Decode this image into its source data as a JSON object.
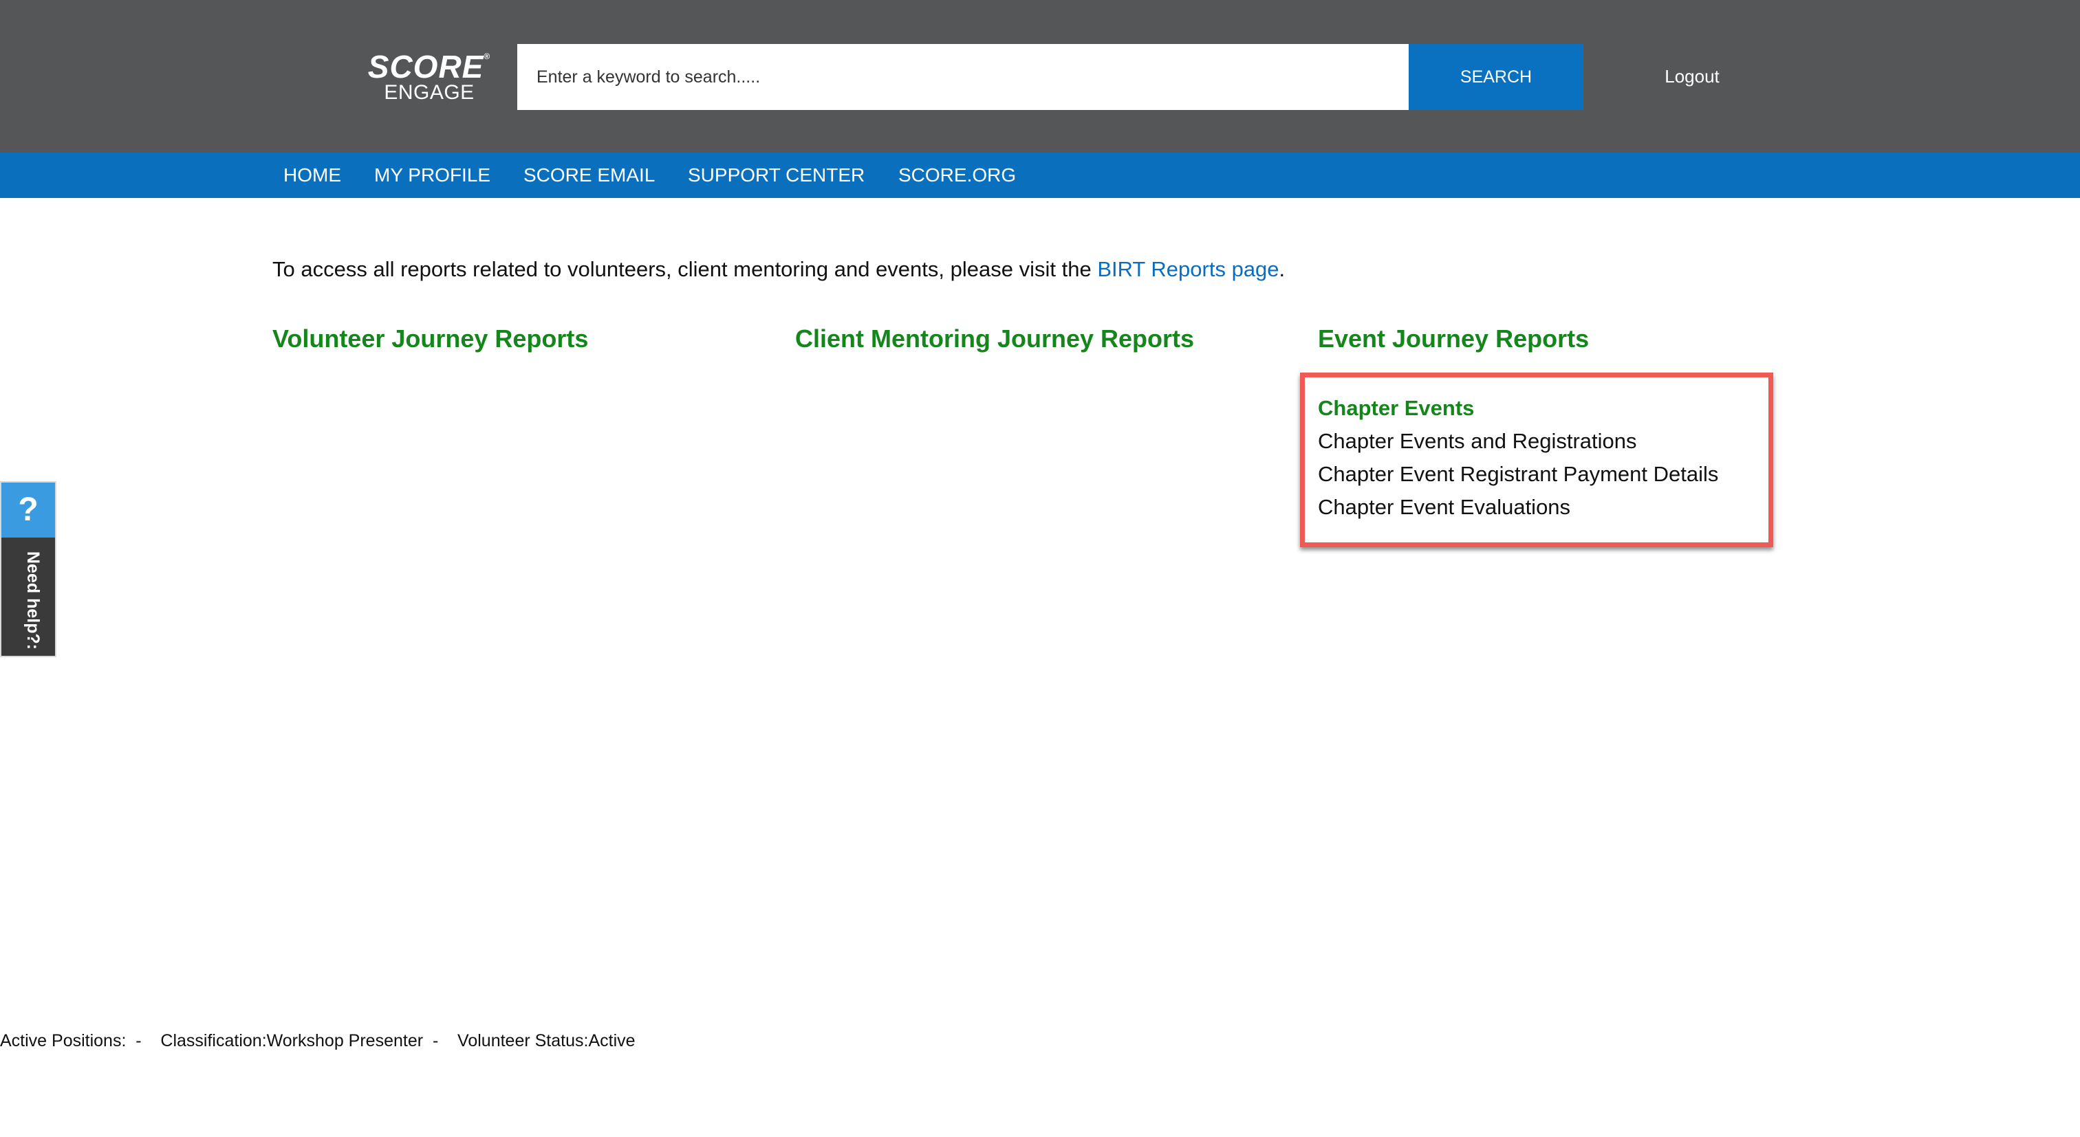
{
  "header": {
    "logo_line1": "SCORE",
    "logo_reg": "®",
    "logo_line2": "ENGAGE",
    "search_placeholder": "Enter a keyword to search.....",
    "search_button": "SEARCH",
    "logout": "Logout"
  },
  "nav": {
    "items": [
      {
        "label": "HOME"
      },
      {
        "label": "MY PROFILE"
      },
      {
        "label": "SCORE EMAIL"
      },
      {
        "label": "SUPPORT CENTER"
      },
      {
        "label": "SCORE.ORG"
      }
    ]
  },
  "intro": {
    "text_before": "To access all reports related to volunteers, client mentoring and events, please visit the ",
    "link": "BIRT Reports page",
    "text_after": "."
  },
  "columns": [
    {
      "heading": "Volunteer Journey Reports"
    },
    {
      "heading": "Client Mentoring Journey Reports"
    },
    {
      "heading": "Event Journey Reports"
    }
  ],
  "event_reports": [
    {
      "label": "Chapter Events"
    },
    {
      "label": "Chapter Events and Registrations"
    },
    {
      "label": "Chapter Event Registrant Payment Details"
    },
    {
      "label": "Chapter Event Evaluations"
    }
  ],
  "help": {
    "icon": "?",
    "label": "Need help?:"
  },
  "footer": {
    "status": "Active Positions:  -    Classification:Workshop Presenter  -    Volunteer Status:Active"
  },
  "colors": {
    "header_bg": "#555658",
    "nav_bg": "#0a70be",
    "heading_green": "#14861c",
    "highlight_red": "#f05a55",
    "link_blue": "#0a6ec0"
  }
}
